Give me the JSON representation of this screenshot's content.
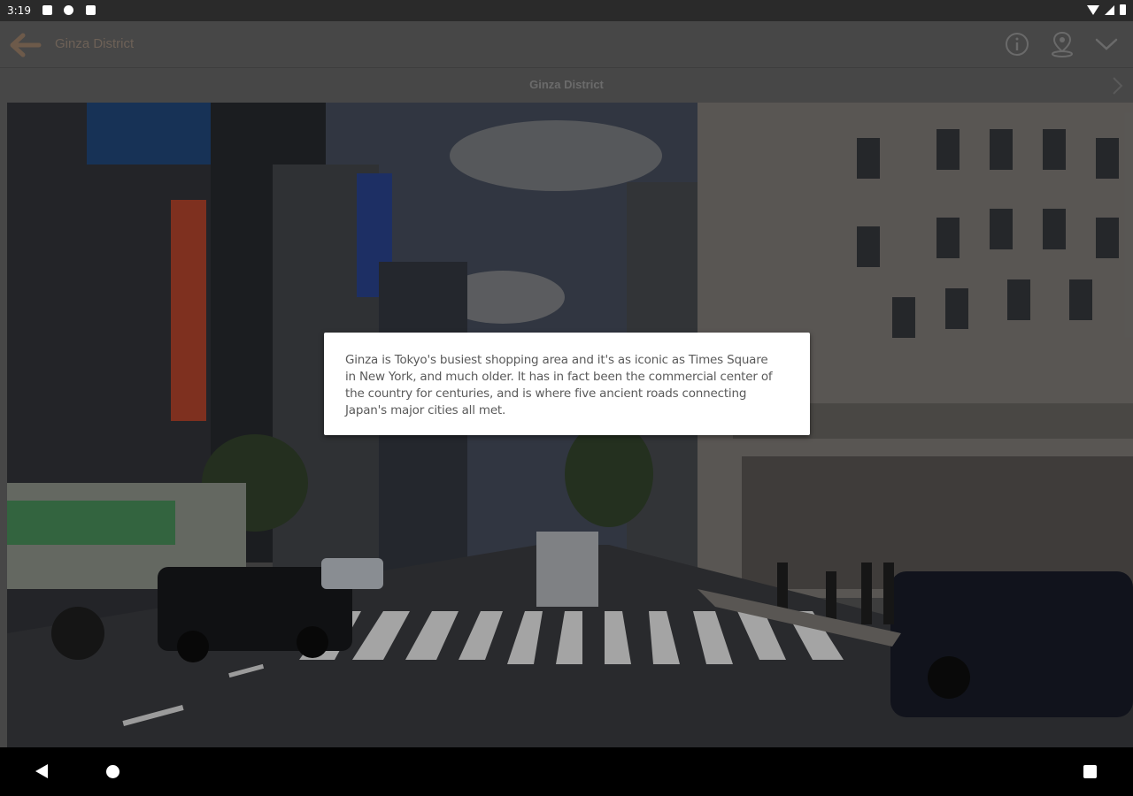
{
  "status_bar": {
    "time": "3:19"
  },
  "app_bar": {
    "title": "Ginza District",
    "icons": [
      "back-arrow-icon",
      "info-icon",
      "location-pin-icon",
      "chevron-down-icon"
    ],
    "title_color": "#6d6157"
  },
  "sub_header": {
    "title": "Ginza District",
    "next_icon": "chevron-right-icon"
  },
  "dialog": {
    "text": "Ginza is Tokyo's busiest shopping area and it's as iconic as Times Square in New York, and much older. It has in fact been the commercial center of the country for centuries, and is where five ancient roads connecting Japan's major cities all met."
  },
  "nav_bar": {
    "icons": [
      "nav-back-icon",
      "nav-home-icon",
      "nav-recents-icon"
    ]
  },
  "colors": {
    "status_bar_bg": "#2a2a2a",
    "app_bar_bg": "#474747",
    "dialog_bg": "#ffffff",
    "dialog_text": "#5a5a5a"
  }
}
